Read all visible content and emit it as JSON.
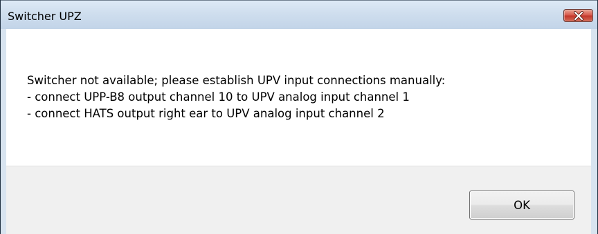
{
  "window": {
    "title": "Switcher UPZ",
    "close_icon": "close-icon"
  },
  "message": {
    "lines": [
      "Switcher not available; please establish UPV input connections manually:",
      "- connect UPP-B8 output channel 10 to UPV analog input channel 1",
      "- connect HATS output right ear to UPV analog input channel 2"
    ]
  },
  "buttons": {
    "ok_label": "OK"
  },
  "colors": {
    "titlebar": "#cfdeee",
    "close_button": "#c2362a",
    "content_background": "#ffffff",
    "button_bar": "#f0f0f0"
  }
}
